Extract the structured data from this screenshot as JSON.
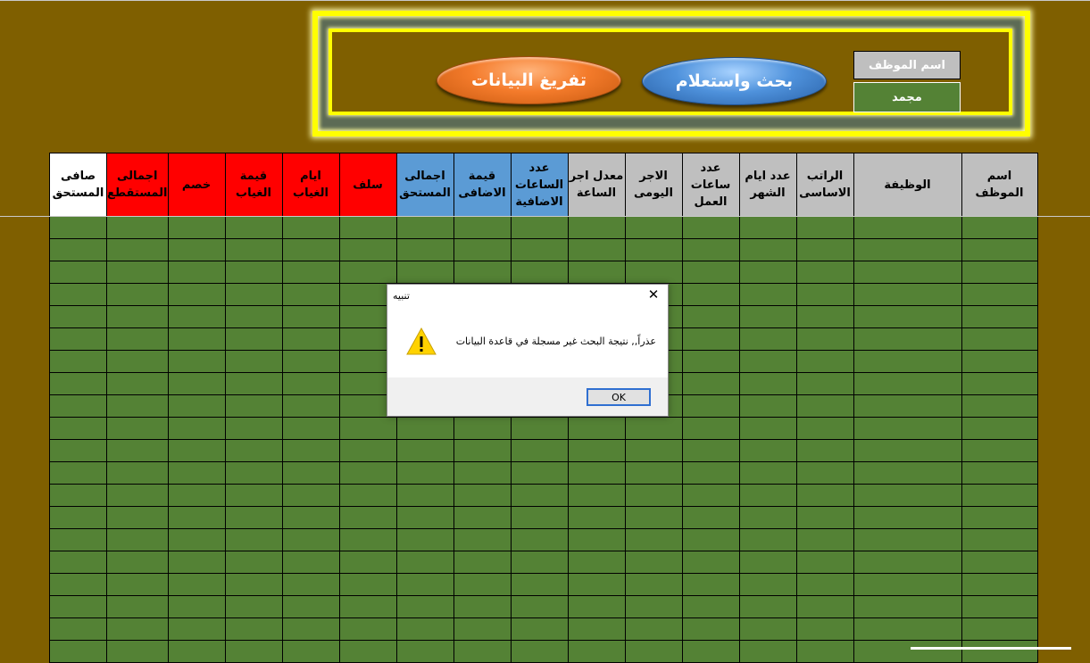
{
  "form": {
    "unload_button": "تفريغ البيانات",
    "search_button": "بحث واستعلام",
    "employee_label": "اسم الموظف",
    "employee_value": "مجمد"
  },
  "table": {
    "headers": [
      "صافى المستحق",
      "اجمالى المستقطع",
      "خصم",
      "قيمة الغياب",
      "ايام الغياب",
      "سلف",
      "اجمالى المستحق",
      "قيمة الاضافى",
      "عدد الساعات الاضافية",
      "معدل اجر الساعة",
      "الاجر اليومى",
      "عدد ساعات العمل",
      "عدد ايام الشهر",
      "الراتب الاساسى",
      "الوظيفة",
      "اسم الموظف"
    ],
    "header_colors": [
      "white",
      "red",
      "red",
      "red",
      "red",
      "red",
      "blue",
      "blue",
      "blue",
      "gray",
      "gray",
      "gray",
      "gray",
      "gray",
      "gray",
      "gray"
    ]
  },
  "dialog": {
    "title": "تنبيه",
    "message": "عذراً,, نتيجة البحث غير مسجلة في قاعدة البيانات",
    "ok_label": "OK",
    "icon": "warning-icon"
  },
  "colors": {
    "background": "#7f5f00",
    "cell_green": "#548235",
    "header_gray": "#bfbfbf",
    "header_blue": "#5b9bd5",
    "header_red": "#ff0000",
    "frame_yellow": "#ffff00"
  }
}
